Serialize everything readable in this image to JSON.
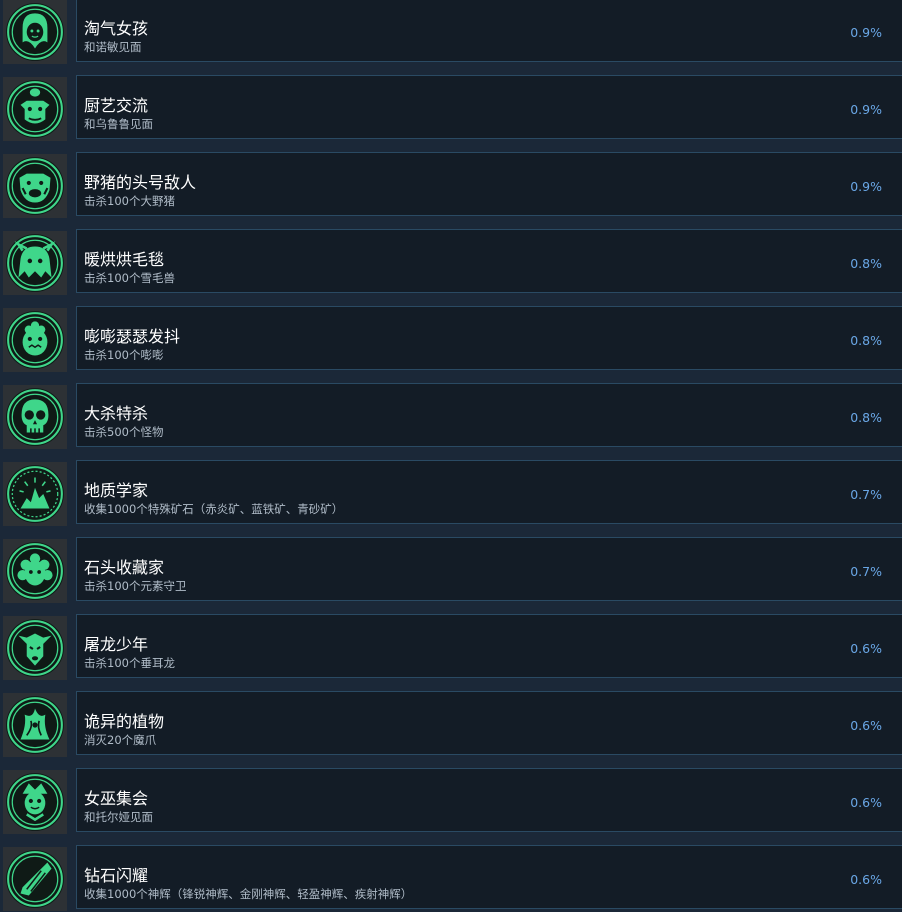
{
  "colors": {
    "background": "#1b2838",
    "card": "#131c26",
    "card_border": "#2a4a63",
    "icon_green": "#3fd68a",
    "icon_bg": "#2d3135",
    "percent_blue": "#6aa7e6"
  },
  "achievements": [
    {
      "title": "淘气女孩",
      "description": "和诺敏见面",
      "percent": "0.9%",
      "icon": "girl-portrait-icon"
    },
    {
      "title": "厨艺交流",
      "description": "和乌鲁鲁见面",
      "percent": "0.9%",
      "icon": "goblin-chef-icon"
    },
    {
      "title": "野猪的头号敌人",
      "description": "击杀100个大野猪",
      "percent": "0.9%",
      "icon": "boar-head-icon"
    },
    {
      "title": "暖烘烘毛毯",
      "description": "击杀100个雪毛兽",
      "percent": "0.8%",
      "icon": "furry-beast-icon"
    },
    {
      "title": "嘭嘭瑟瑟发抖",
      "description": "击杀100个嘭嘭",
      "percent": "0.8%",
      "icon": "shaggy-creature-icon"
    },
    {
      "title": "大杀特杀",
      "description": "击杀500个怪物",
      "percent": "0.8%",
      "icon": "skull-icon"
    },
    {
      "title": "地质学家",
      "description": "收集1000个特殊矿石（赤炎矿、蓝铁矿、青砂矿）",
      "percent": "0.7%",
      "icon": "ore-pile-icon"
    },
    {
      "title": "石头收藏家",
      "description": "击杀100个元素守卫",
      "percent": "0.7%",
      "icon": "rock-guardian-icon"
    },
    {
      "title": "屠龙少年",
      "description": "击杀100个垂耳龙",
      "percent": "0.6%",
      "icon": "dragon-head-icon"
    },
    {
      "title": "诡异的植物",
      "description": "消灭20个魔爪",
      "percent": "0.6%",
      "icon": "thorn-plant-icon"
    },
    {
      "title": "女巫集会",
      "description": "和托尔娅见面",
      "percent": "0.6%",
      "icon": "witch-icon"
    },
    {
      "title": "钻石闪耀",
      "description": "收集1000个神辉（锋锐神辉、金刚神辉、轻盈神辉、疾射神辉）",
      "percent": "0.6%",
      "icon": "crystal-shard-icon"
    }
  ]
}
